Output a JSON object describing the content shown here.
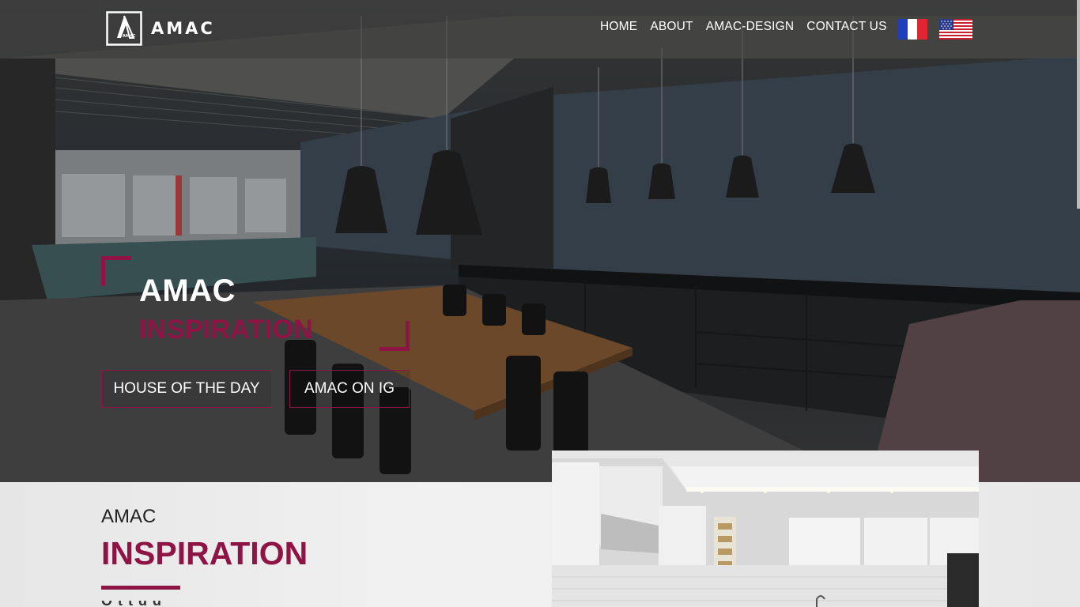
{
  "brand": {
    "name": "AMAC",
    "mark_text": "AMAC"
  },
  "nav": {
    "items": [
      "HOME",
      "ABOUT",
      "AMAC-DESIGN",
      "CONTACT US"
    ],
    "flags": [
      "france-flag-icon",
      "usa-flag-icon"
    ]
  },
  "hero": {
    "line1": "AMAC",
    "line2": "INSPIRATION",
    "buttons": {
      "house": "HOUSE OF THE DAY",
      "ig": "AMAC ON IG"
    }
  },
  "section": {
    "line1": "AMAC",
    "line2": "INSPIRATION",
    "cut_text": "O t t d d"
  },
  "colors": {
    "accent": "#8e1446",
    "text_light": "#ffffff",
    "text_dark": "#222222"
  }
}
